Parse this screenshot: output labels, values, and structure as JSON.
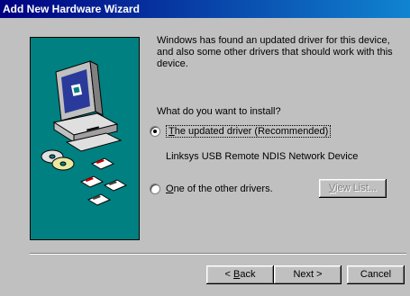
{
  "window": {
    "title": "Add New Hardware Wizard"
  },
  "intro": "Windows has found an updated driver for this device, and also some other drivers that should work with this device.",
  "question": "What do you want to install?",
  "options": [
    {
      "label": "The updated driver (Recommended)",
      "accel": "T",
      "rest": "he updated driver (Recommended)",
      "selected": true
    },
    {
      "label": "One of the other drivers.",
      "accel": "O",
      "rest": "ne of the other drivers.",
      "selected": false
    }
  ],
  "device_name": "Linksys USB Remote NDIS Network Device",
  "buttons": {
    "view_list": {
      "label": "View List...",
      "accel": "V",
      "rest": "iew List..."
    },
    "back": {
      "label": "< Back",
      "pre": "< ",
      "accel": "B",
      "rest": "ack"
    },
    "next": {
      "label": "Next >"
    },
    "cancel": {
      "label": "Cancel"
    }
  },
  "colors": {
    "title_start": "#000080",
    "title_end": "#1084d0",
    "art_bg": "#008080",
    "face": "#c0c0c0"
  },
  "icons": [
    "computer-icon",
    "cd-disc-icon",
    "floppy-disk-icon"
  ]
}
